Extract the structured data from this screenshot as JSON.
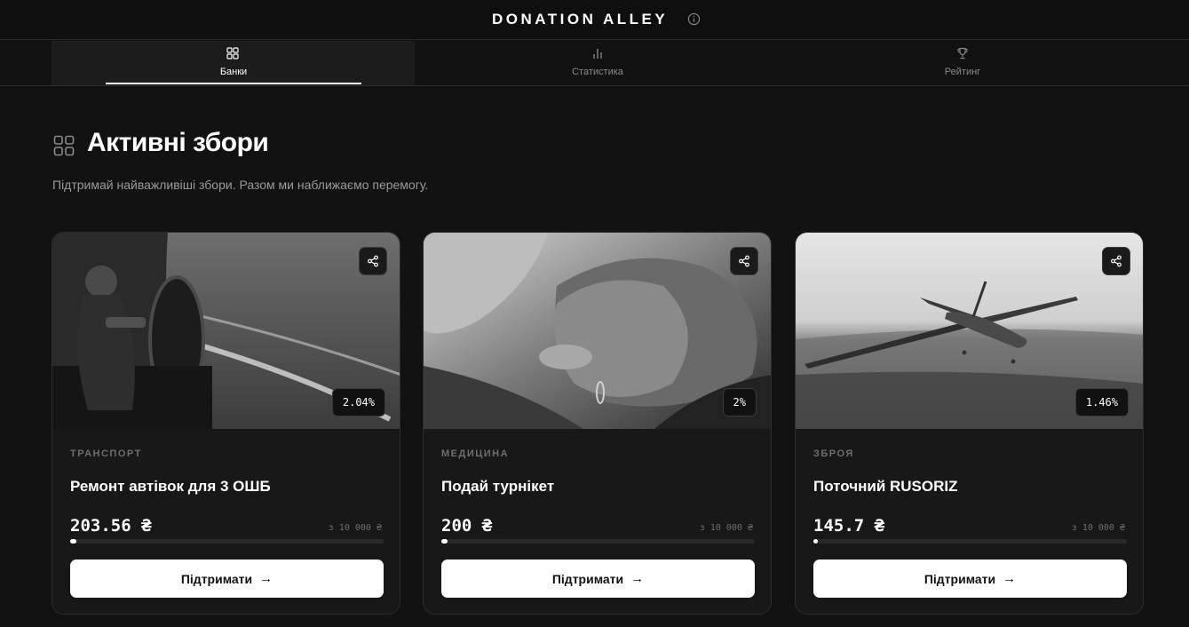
{
  "app": {
    "brand": "DONATION ALLEY"
  },
  "tabs": [
    {
      "label": "Банки",
      "icon": "grid-icon",
      "active": true
    },
    {
      "label": "Статистика",
      "icon": "bar-chart-icon",
      "active": false
    },
    {
      "label": "Рейтинг",
      "icon": "trophy-icon",
      "active": false
    }
  ],
  "section": {
    "title": "Активні збори",
    "subtitle": "Підтримай найважливіші збори. Разом ми наближаємо перемогу.",
    "icon": "grid-icon"
  },
  "cards": [
    {
      "category": "ТРАНСПОРТ",
      "title": "Ремонт автівок для 3 ОШБ",
      "amount": "203.56 ₴",
      "goal": "з 10 000 ₴",
      "percent_label": "2.04%",
      "progress": 0.0204,
      "button": "Підтримати",
      "image": "car-repair-photo"
    },
    {
      "category": "МЕДИЦИНА",
      "title": "Подай турнікет",
      "amount": "200 ₴",
      "goal": "з 10 000 ₴",
      "percent_label": "2%",
      "progress": 0.02,
      "button": "Підтримати",
      "image": "holding-hands-photo"
    },
    {
      "category": "ЗБРОЯ",
      "title": "Поточний RUSORIZ",
      "amount": "145.7 ₴",
      "goal": "з 10 000 ₴",
      "percent_label": "1.46%",
      "progress": 0.0146,
      "button": "Підтримати",
      "image": "drone-photo"
    }
  ],
  "colors": {
    "background": "#121212",
    "card": "#181818",
    "accent": "#ffffff",
    "muted": "#6e6e6e"
  }
}
